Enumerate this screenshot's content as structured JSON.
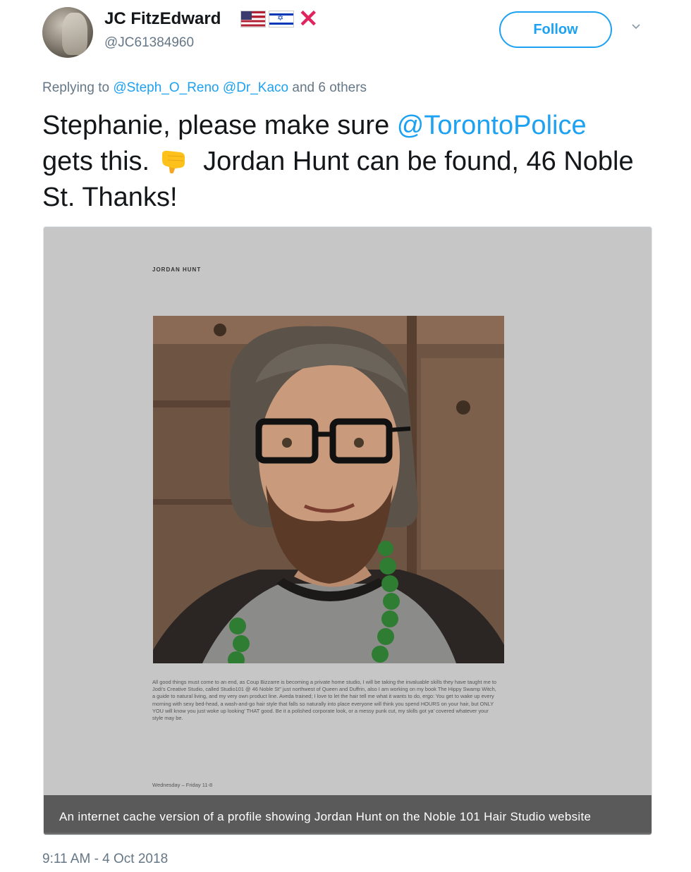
{
  "author": {
    "display_name": "JC FitzEdward",
    "handle": "@JC61384960",
    "badges": [
      "us-flag-icon",
      "israel-flag-icon",
      "red-x-icon"
    ]
  },
  "follow_button": {
    "label": "Follow"
  },
  "reply_context": {
    "prefix": "Replying to",
    "mention_1": "@Steph_O_Reno",
    "mention_2": "@Dr_Kaco",
    "suffix": "and 6 others"
  },
  "tweet": {
    "part1": "Stephanie, please make sure ",
    "mention": "@TorontoPolice",
    "part2": "gets this.",
    "emoji": "backhand-index-pointing-down-icon",
    "part3": "Jordan Hunt can be found, 46 Noble St. Thanks!"
  },
  "media": {
    "site_heading": "JORDAN HUNT",
    "bio": "All good things must come to an end, as Coup Bizzarre is becoming a private home studio, I will be taking the invaluable skills they have taught me to Jodi's Creative Studio, called Studio101 @ 46 Noble St\" just northwest of Queen and Duffrin, also I am working on my book The Hippy Swamp Witch, a guide to natural living, and my very own product line. Aveda trained; I love to let the hair tell me what it wants to do, ergo: You get to wake up every morning with sexy bed-head, a wash-and-go hair style that falls so naturally into place everyone will think you spend HOURS on your hair, but ONLY YOU will know you just woke up looking' THAT good. Be it a polished corporate look, or a messy punk cut, my skills got ya' covered whatever your style may be.",
    "hours": "Wednesday – Friday 11-8",
    "caption": "An internet cache version of a profile showing Jordan Hunt on the Noble 101 Hair Studio website"
  },
  "timestamp": "9:11 AM - 4 Oct 2018",
  "colors": {
    "link": "#1da1f2",
    "muted": "#657786",
    "text": "#14171a"
  }
}
